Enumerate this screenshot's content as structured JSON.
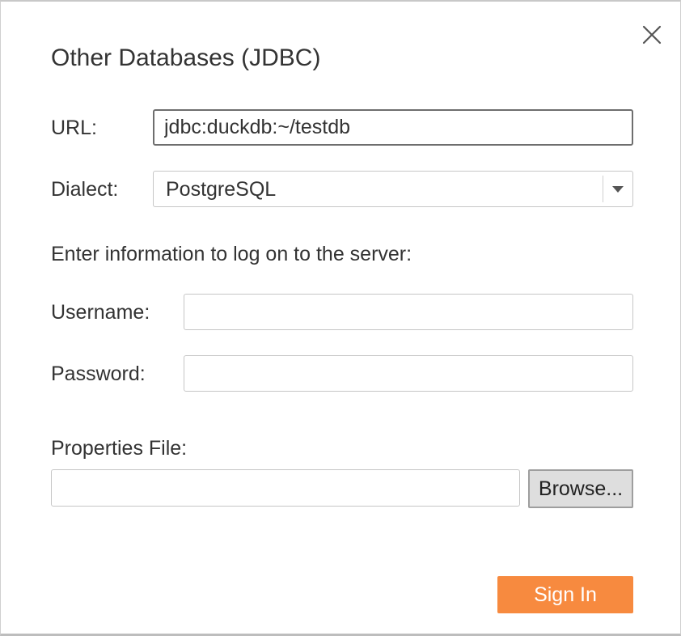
{
  "dialog": {
    "title": "Other Databases (JDBC)",
    "close_icon": "close-icon"
  },
  "url": {
    "label": "URL:",
    "value": "jdbc:duckdb:~/testdb",
    "placeholder": ""
  },
  "dialect": {
    "label": "Dialect:",
    "selected": "PostgreSQL",
    "arrow_icon": "chevron-down-icon"
  },
  "login": {
    "instruction": "Enter information to log on to the server:",
    "username_label": "Username:",
    "username_value": "",
    "password_label": "Password:",
    "password_value": ""
  },
  "properties": {
    "label": "Properties File:",
    "value": "",
    "browse_label": "Browse..."
  },
  "actions": {
    "signin_label": "Sign In"
  },
  "colors": {
    "accent": "#f78a3f",
    "text": "#333333",
    "border": "#c6c6c6",
    "focused_border": "#6e6e6e"
  }
}
